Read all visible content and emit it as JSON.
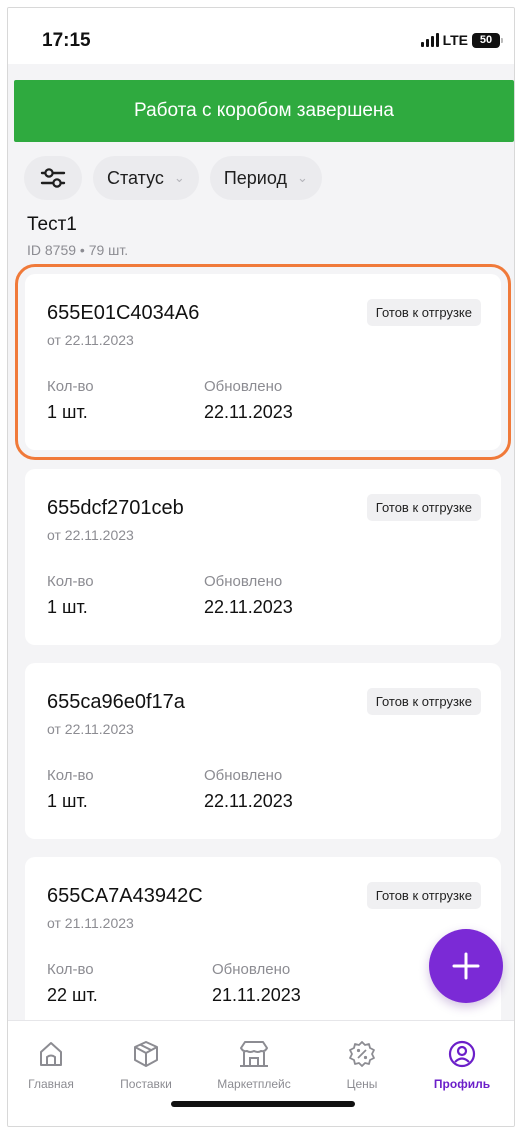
{
  "status_bar": {
    "time": "17:15",
    "network": "LTE",
    "battery": "50"
  },
  "toast": {
    "message": "Работа с коробом завершена"
  },
  "filters": {
    "status_label": "Статус",
    "period_label": "Период"
  },
  "group": {
    "title": "Тест1",
    "subtitle": "ID 8759 • 79 шт."
  },
  "cards": [
    {
      "id": "655E01C4034A6",
      "date": "от 22.11.2023",
      "badge": "Готов к отгрузке",
      "qty_label": "Кол-во",
      "qty": "1 шт.",
      "updated_label": "Обновлено",
      "updated": "22.11.2023"
    },
    {
      "id": "655dcf2701ceb",
      "date": "от 22.11.2023",
      "badge": "Готов к отгрузке",
      "qty_label": "Кол-во",
      "qty": "1 шт.",
      "updated_label": "Обновлено",
      "updated": "22.11.2023"
    },
    {
      "id": "655ca96e0f17a",
      "date": "от 22.11.2023",
      "badge": "Готов к отгрузке",
      "qty_label": "Кол-во",
      "qty": "1 шт.",
      "updated_label": "Обновлено",
      "updated": "22.11.2023"
    },
    {
      "id": "655CA7A43942C",
      "date": "от 21.11.2023",
      "badge": "Готов к отгрузке",
      "qty_label": "Кол-во",
      "qty": "22 шт.",
      "updated_label": "Обновлено",
      "updated": "21.11.2023"
    }
  ],
  "tabs": [
    {
      "label": "Главная",
      "icon": "home-icon"
    },
    {
      "label": "Поставки",
      "icon": "box-icon"
    },
    {
      "label": "Маркетплейс",
      "icon": "store-icon"
    },
    {
      "label": "Цены",
      "icon": "percent-badge-icon"
    },
    {
      "label": "Профиль",
      "icon": "profile-icon",
      "active": true
    }
  ],
  "colors": {
    "toast_green": "#2faa3f",
    "accent_purple": "#7b2ad6",
    "highlight_orange": "#f07a3a"
  }
}
